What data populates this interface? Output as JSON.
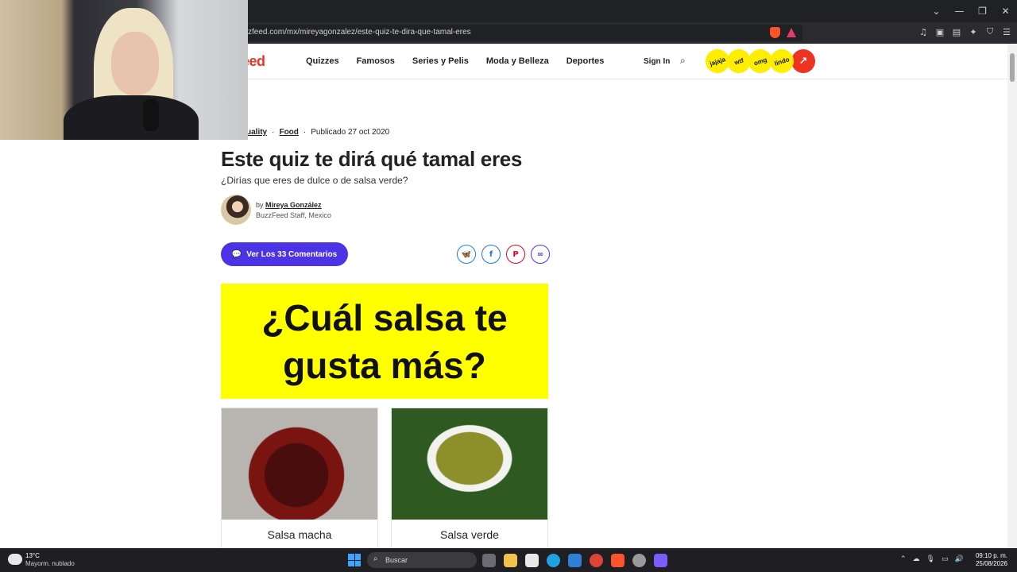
{
  "browser": {
    "url": "zfeed.com/mx/mireyagonzalez/este-quiz-te-dira-que-tamal-eres",
    "window_controls": [
      "⌄",
      "—",
      "❐",
      "✕"
    ],
    "right_icons": [
      "♫",
      "▣",
      "▤",
      "✦",
      "⛉",
      "☰"
    ]
  },
  "site": {
    "logo": "zFeed",
    "nav": [
      "Quizzes",
      "Famosos",
      "Series y Pelis",
      "Moda y Belleza",
      "Deportes"
    ],
    "signin": "Sign In",
    "badges": [
      "jajaja",
      "wtf",
      "omg",
      "lindo",
      "↗"
    ]
  },
  "article": {
    "breadcrumb": {
      "first": "uality",
      "sep1": "·",
      "second": "Food",
      "sep2": "·",
      "published": "Publicado 27 oct 2020"
    },
    "title": "Este quiz te dirá qué tamal eres",
    "subtitle": "¿Dirías que eres de dulce o de salsa verde?",
    "author": {
      "by": "by",
      "name": "Mireya González",
      "role": "BuzzFeed Staff, Mexico"
    },
    "comments_button": "Ver Los 33 Comentarios",
    "shares": [
      "bluesky",
      "facebook",
      "pinterest",
      "link"
    ],
    "question_banner": "¿Cuál salsa te gusta más?",
    "options": [
      {
        "label": "Salsa macha"
      },
      {
        "label": "Salsa verde"
      }
    ]
  },
  "taskbar": {
    "weather_temp": "13°C",
    "weather_desc": "Mayorm. nublado",
    "search_placeholder": "Buscar",
    "clock_time": "09:10 p. m.",
    "clock_date": "25/08/2026"
  },
  "colors": {
    "brand_red": "#ee3322",
    "comments_purple": "#4d33e6",
    "banner_yellow": "#ffff00"
  }
}
